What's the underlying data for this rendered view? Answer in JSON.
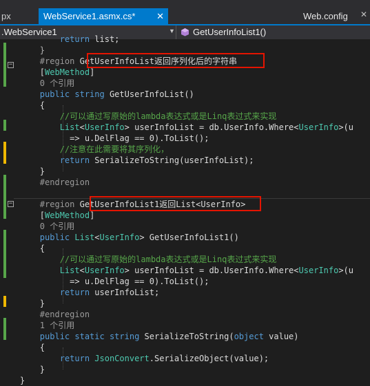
{
  "tabs": {
    "left": "px",
    "active": "WebService1.asmx.cs*",
    "active_close": "✕",
    "right": "Web.config",
    "right_close": "✕"
  },
  "navbar": {
    "class": ".WebService1",
    "member": "GetUserInfoList1()"
  },
  "code": [
    {
      "t": "            return list;"
    },
    {
      "t": "        }"
    },
    {
      "t": "        #region GetUserInfoList返回序列化后的字符串"
    },
    {
      "t": "        [WebMethod]"
    },
    {
      "t": "        0 个引用"
    },
    {
      "t": "        public string GetUserInfoList()"
    },
    {
      "t": "        {"
    },
    {
      "t": "            //可以通过写原始的lambda表达式或是Linq表过式来实现"
    },
    {
      "t": "            List<UserInfo> userInfoList = db.UserInfo.Where(UserInfo>(u"
    },
    {
      "t": "              => u.DelFlag == 0).ToList();"
    },
    {
      "t": "            //注意在此需要将其序列化，"
    },
    {
      "t": "            return SerializeToString(userInfoList);"
    },
    {
      "t": "        }"
    },
    {
      "t": "        #endregion"
    },
    {
      "t": ""
    },
    {
      "t": "        #region GetUserInfoList1返回List<UserInfo>"
    },
    {
      "t": "        [WebMethod]"
    },
    {
      "t": "        0 个引用"
    },
    {
      "t": "        public List<UserInfo> GetUserInfoList1()"
    },
    {
      "t": "        {"
    },
    {
      "t": "            //可以通过写原始的lambda表达式或是Linq表过式来实现"
    },
    {
      "t": "            List<UserInfo> userInfoList = db.UserInfo.Where<UserInfo>(u"
    },
    {
      "t": "              => u.DelFlag == 0).ToList();"
    },
    {
      "t": "            return userInfoList;"
    },
    {
      "t": "        }"
    },
    {
      "t": "        #endregion"
    },
    {
      "t": "        1 个引用"
    },
    {
      "t": "        public static string SerializeToString(object value)"
    },
    {
      "t": "        {"
    },
    {
      "t": "            return JsonConvert.SerializeObject(value);"
    },
    {
      "t": "        }"
    },
    {
      "t": "    }"
    }
  ],
  "colors": {
    "editor_bg": "#1e1e1e",
    "keyword": "#569cd6",
    "type": "#4ec9b0",
    "comment": "#57a64a",
    "highlight_box": "#e51400",
    "accent": "#007acc"
  }
}
